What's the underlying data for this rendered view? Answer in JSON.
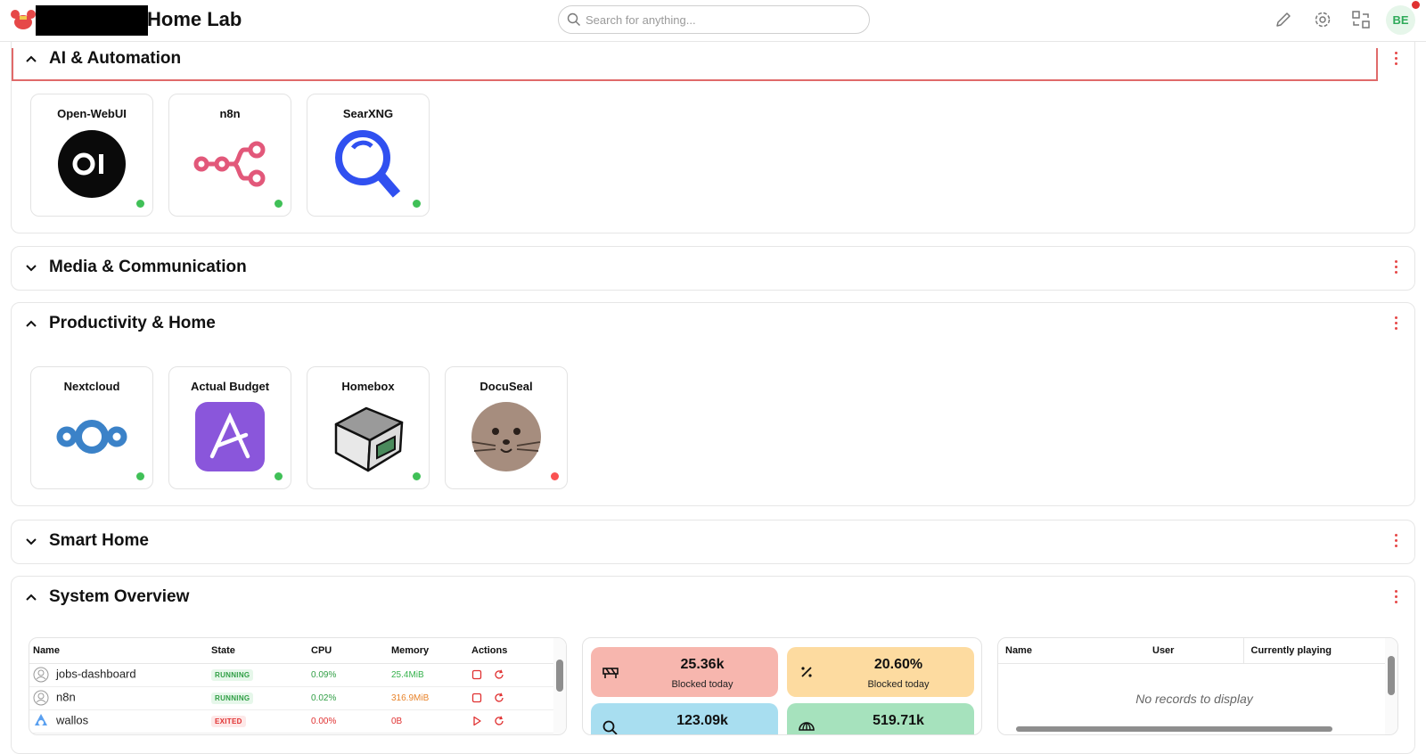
{
  "header": {
    "title": "Home Lab",
    "search_placeholder": "Search for anything...",
    "avatar_initials": "BE"
  },
  "sections": {
    "ai": {
      "title": "AI & Automation",
      "expanded": true,
      "apps": [
        {
          "name": "Open-WebUI",
          "status": "online",
          "icon": "open-webui-logo"
        },
        {
          "name": "n8n",
          "status": "online",
          "icon": "n8n-logo"
        },
        {
          "name": "SearXNG",
          "status": "online",
          "icon": "searxng-logo"
        }
      ]
    },
    "media": {
      "title": "Media & Communication",
      "expanded": false
    },
    "productivity": {
      "title": "Productivity & Home",
      "expanded": true,
      "apps": [
        {
          "name": "Nextcloud",
          "status": "online",
          "icon": "nextcloud-logo"
        },
        {
          "name": "Actual Budget",
          "status": "online",
          "icon": "actual-budget-logo"
        },
        {
          "name": "Homebox",
          "status": "online",
          "icon": "homebox-logo"
        },
        {
          "name": "DocuSeal",
          "status": "offline",
          "icon": "docuseal-logo"
        }
      ]
    },
    "smart_home": {
      "title": "Smart Home",
      "expanded": false
    },
    "system": {
      "title": "System Overview",
      "expanded": true
    }
  },
  "docker": {
    "columns": [
      "Name",
      "State",
      "CPU",
      "Memory",
      "Actions"
    ],
    "rows": [
      {
        "name": "jobs-dashboard",
        "state": "RUNNING",
        "cpu": "0.09%",
        "memory": "25.4MiB"
      },
      {
        "name": "n8n",
        "state": "RUNNING",
        "cpu": "0.02%",
        "memory": "316.9MiB"
      },
      {
        "name": "wallos",
        "state": "EXITED",
        "cpu": "0.00%",
        "memory": "0B"
      }
    ]
  },
  "dns_stats": [
    {
      "value": "25.36k",
      "label": "Blocked today",
      "color": "#f7b6ae",
      "icon": "barrier-icon"
    },
    {
      "value": "20.60%",
      "label": "Blocked today",
      "color": "#fddba0",
      "icon": "percent-icon"
    },
    {
      "value": "123.09k",
      "label": "",
      "color": "#a8def0",
      "icon": "search-icon"
    },
    {
      "value": "519.71k",
      "label": "",
      "color": "#a6e2bd",
      "icon": "globe-icon"
    }
  ],
  "media_sessions": {
    "columns": [
      "Name",
      "User",
      "Currently playing"
    ],
    "empty_message": "No records to display"
  },
  "colors": {
    "online": "#40c057",
    "offline": "#fa5252",
    "accent": "#e64848"
  }
}
